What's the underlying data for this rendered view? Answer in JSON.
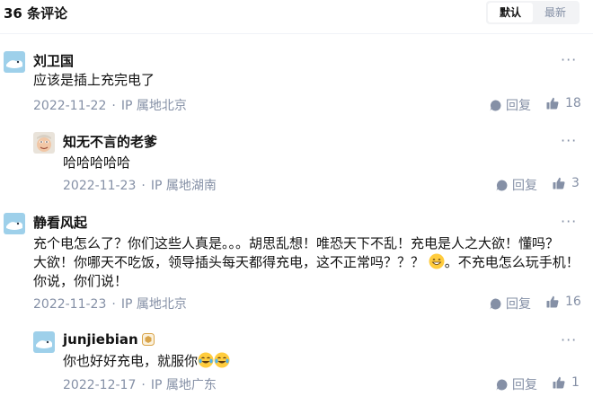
{
  "header": {
    "count_title": "36 条评论",
    "sort_default": "默认",
    "sort_latest": "最新"
  },
  "comments": [
    {
      "author": "刘卫国",
      "text": "应该是插上充完电了",
      "date": "2022-11-22",
      "location": "IP 属地北京",
      "reply_label": "回复",
      "likes": "18"
    },
    {
      "author": "知无不言的老爹",
      "text": "哈哈哈哈哈",
      "date": "2022-11-23",
      "location": "IP 属地湖南",
      "reply_label": "回复",
      "likes": "3"
    },
    {
      "author": "静看风起",
      "text_line1": "充个电怎么了？你们这些人真是。。。胡思乱想！唯恐天下不乱！充电是人之大欲！懂吗？",
      "text_line2a": "大欲！你哪天不吃饭，领导插头每天都得充电，这不正常吗？？？",
      "text_line2b": "。不充电怎么玩手机！",
      "text_line3": "你说，你们说！",
      "date": "2022-11-23",
      "location": "IP 属地北京",
      "reply_label": "回复",
      "likes": "16"
    },
    {
      "author": "junjiebian",
      "text": "你也好好充电，就服你",
      "date": "2022-12-17",
      "location": "IP 属地广东",
      "reply_label": "回复",
      "likes": "1"
    }
  ],
  "icons": {
    "more": "more-dots-icon",
    "reply": "speech-bubble-icon",
    "like": "thumbs-up-icon",
    "badge": "creator-badge-icon",
    "emoji_grin": "grinning-face-icon",
    "emoji_laugh": "tears-of-joy-icon"
  },
  "colors": {
    "text_primary": "#121212",
    "text_secondary": "#8590a6",
    "toggle_bg": "#f2f3f5"
  }
}
